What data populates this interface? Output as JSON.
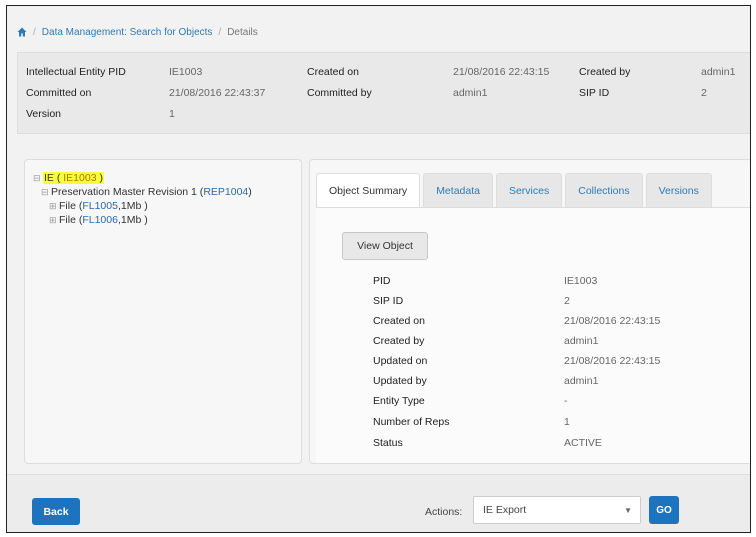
{
  "breadcrumb": {
    "home_icon": "home-icon",
    "link": "Data Management: Search for Objects",
    "current": "Details",
    "separator": "/"
  },
  "info": {
    "ie_pid_label": "Intellectual Entity PID",
    "ie_pid_value": "IE1003",
    "committed_on_label": "Committed on",
    "committed_on_value": "21/08/2016 22:43:37",
    "version_label": "Version",
    "version_value": "1",
    "created_on_label": "Created on",
    "created_on_value": "21/08/2016 22:43:15",
    "committed_by_label": "Committed by",
    "committed_by_value": "admin1",
    "created_by_label": "Created by",
    "created_by_value": "admin1",
    "sip_id_label": "SIP ID",
    "sip_id_value": "2"
  },
  "tree": {
    "root": {
      "prefix": "IE ( ",
      "link": "IE1003",
      "suffix": " )"
    },
    "rep": {
      "prefix": "Preservation Master Revision 1 ( ",
      "link": "REP1004",
      "suffix": " )"
    },
    "files": [
      {
        "prefix": "File ( ",
        "link": "FL1005",
        "suffix": " ,1Mb )"
      },
      {
        "prefix": "File ( ",
        "link": "FL1006",
        "suffix": " ,1Mb )"
      }
    ]
  },
  "tabs": [
    "Object Summary",
    "Metadata",
    "Services",
    "Collections",
    "Versions"
  ],
  "view_object_label": "View Object",
  "summary": [
    {
      "k": "PID",
      "v": "IE1003"
    },
    {
      "k": "SIP ID",
      "v": "2"
    },
    {
      "k": "Created on",
      "v": "21/08/2016 22:43:15"
    },
    {
      "k": "Created by",
      "v": "admin1"
    },
    {
      "k": "Updated on",
      "v": "21/08/2016 22:43:15"
    },
    {
      "k": "Updated by",
      "v": "admin1"
    },
    {
      "k": "Entity Type",
      "v": "-"
    },
    {
      "k": "Number of Reps",
      "v": "1"
    },
    {
      "k": "Status",
      "v": "ACTIVE"
    }
  ],
  "bottom": {
    "back_label": "Back",
    "actions_label": "Actions:",
    "actions_selected": "IE Export",
    "go_label": "GO"
  },
  "colors": {
    "accent": "#1e73be",
    "link": "#2e7bb5",
    "highlight": "#fbff3b"
  }
}
